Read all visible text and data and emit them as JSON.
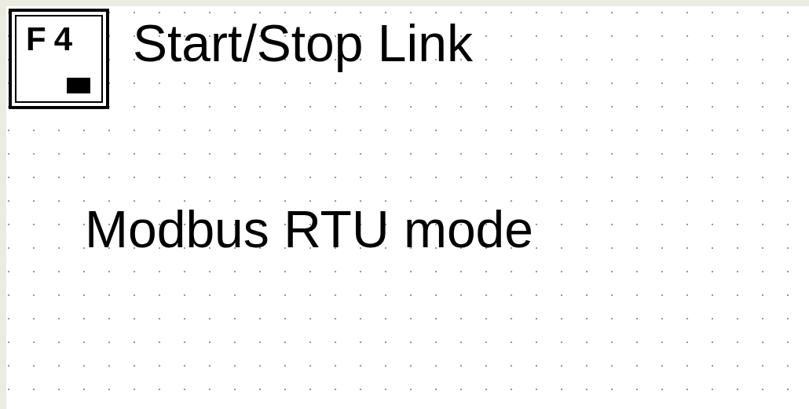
{
  "function_key": {
    "label": "F4"
  },
  "key_caption": "Start/Stop Link",
  "mode_text": "Modbus RTU mode"
}
